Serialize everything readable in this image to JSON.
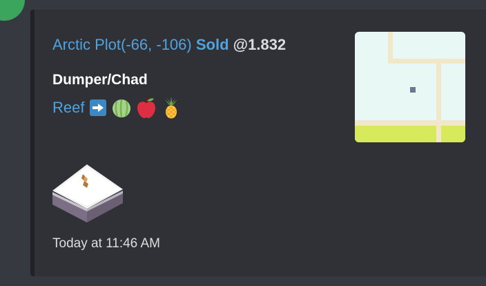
{
  "embed": {
    "title": {
      "plot_name": "Arctic Plot(-66, -106)",
      "status": "Sold",
      "price": "@1.832"
    },
    "field": {
      "name": "Dumper/Chad",
      "value_link": "Reef"
    },
    "icons": [
      "arrow-right-icon",
      "melon-icon",
      "apple-icon",
      "pineapple-icon"
    ],
    "footer": {
      "timestamp": "Today at 11:46 AM"
    }
  },
  "colors": {
    "background": "#36393f",
    "embed_background": "#2f3136",
    "embed_bar": "#202225",
    "link": "#4fa3e0",
    "text": "#dcddde",
    "heading": "#ffffff",
    "map_ground": "#e8f8f5",
    "map_road": "#f3e7c9",
    "map_grass": "#d7ea5c"
  }
}
